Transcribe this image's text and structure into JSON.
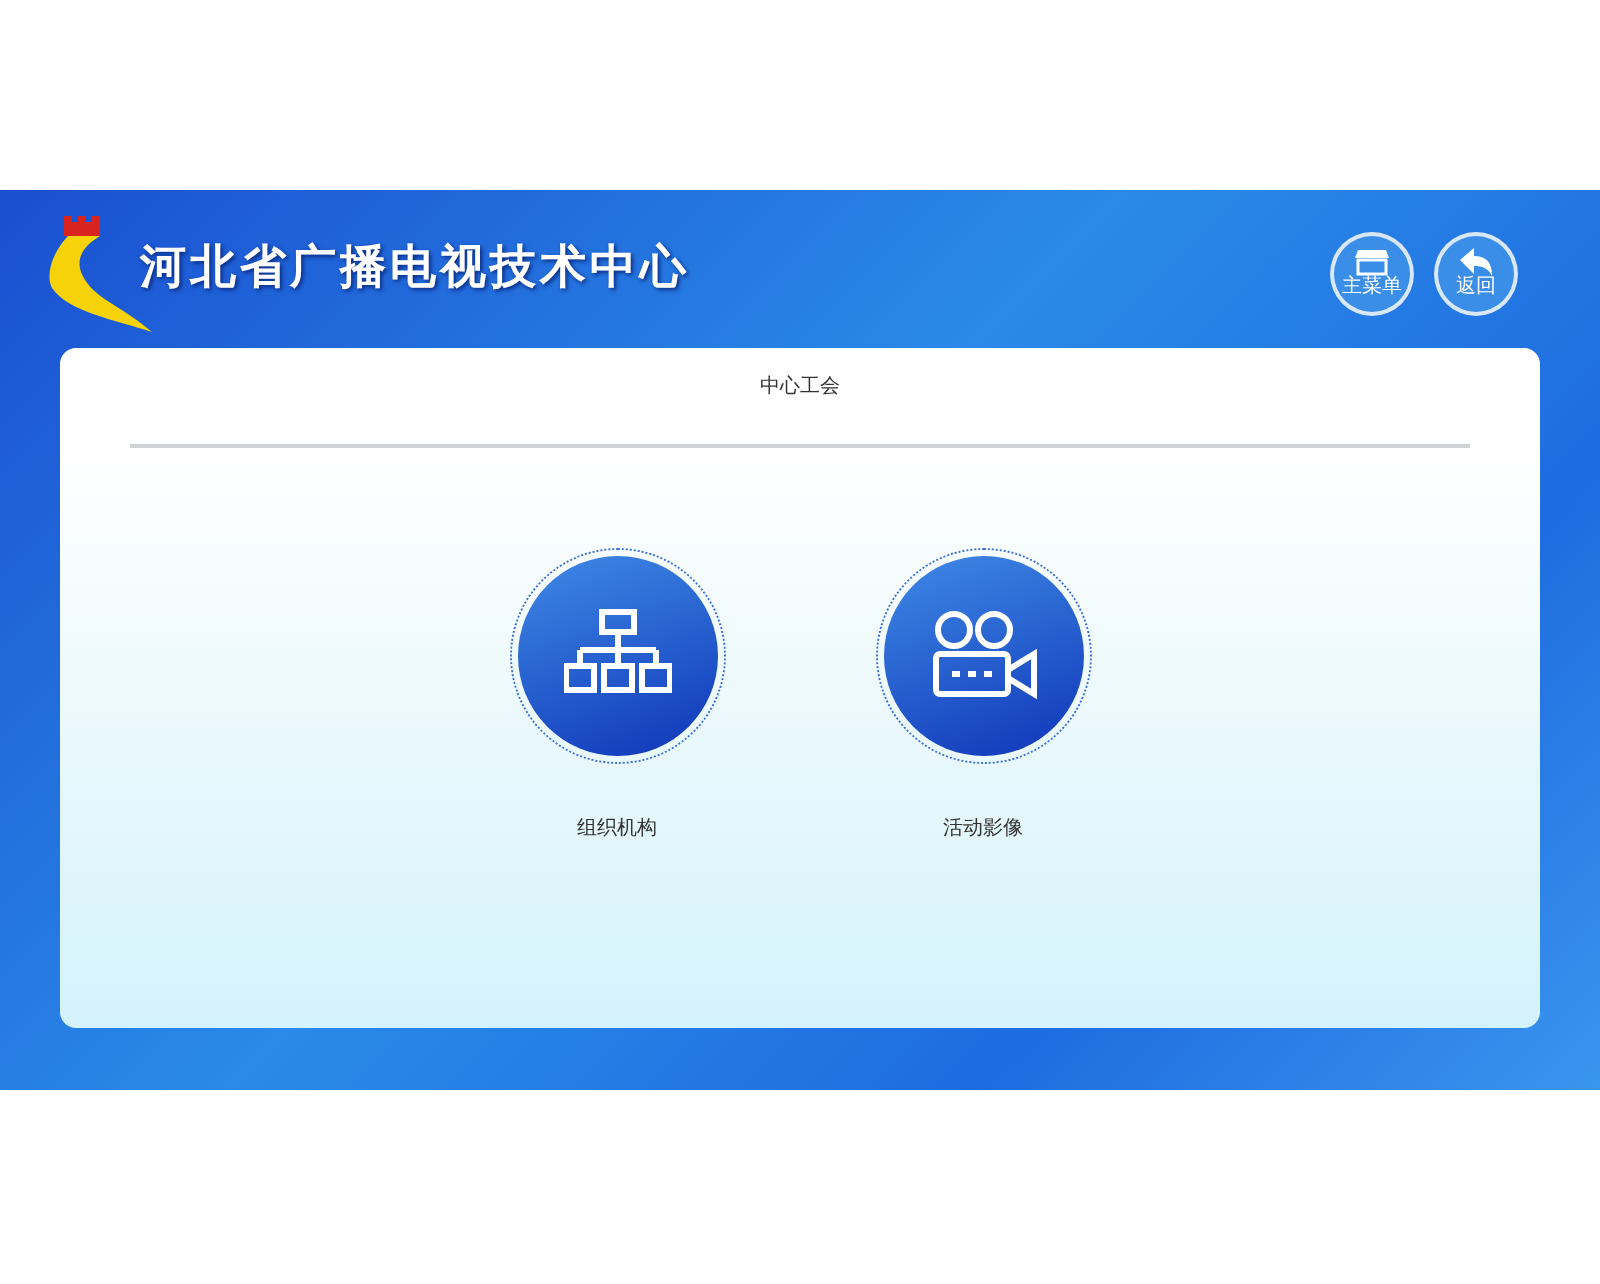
{
  "header": {
    "title": "河北省广播电视技术中心",
    "buttons": [
      {
        "label": "主菜单",
        "kind": "store"
      },
      {
        "label": "返回",
        "kind": "back"
      }
    ]
  },
  "panel": {
    "title": "中心工会",
    "tiles": [
      {
        "label": "组织机构",
        "kind": "org"
      },
      {
        "label": "活动影像",
        "kind": "video"
      }
    ]
  }
}
